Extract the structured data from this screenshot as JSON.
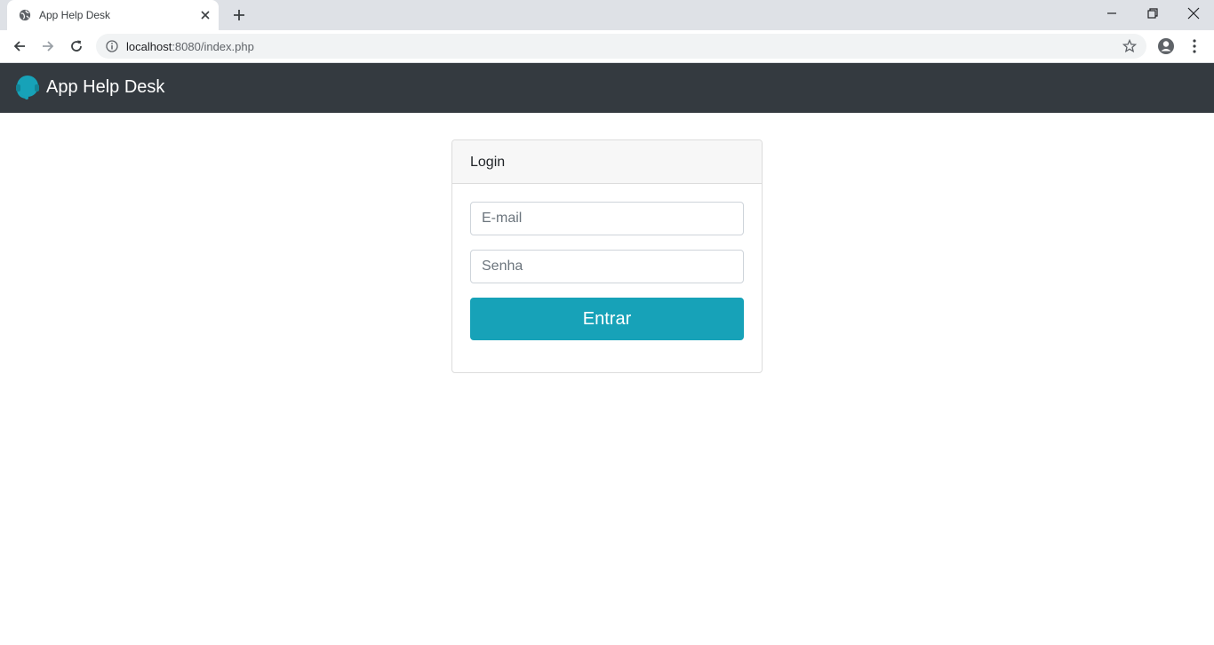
{
  "browser": {
    "tab_title": "App Help Desk",
    "url_host": "localhost",
    "url_path": ":8080/index.php"
  },
  "navbar": {
    "brand_text": "App Help Desk",
    "background_color": "#343a40",
    "logo_color": "#17a2b8"
  },
  "login_card": {
    "header": "Login",
    "email_placeholder": "E-mail",
    "password_placeholder": "Senha",
    "submit_label": "Entrar",
    "button_color": "#17a2b8"
  }
}
